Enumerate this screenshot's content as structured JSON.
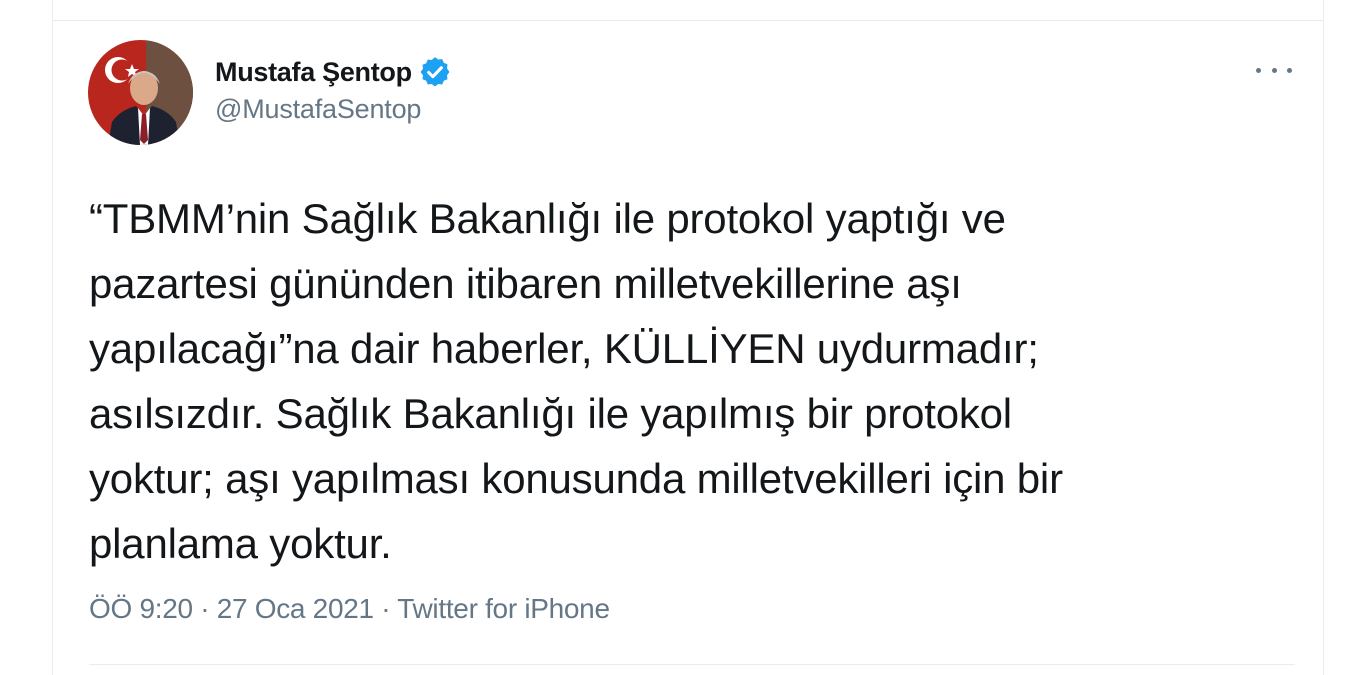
{
  "tweet": {
    "author": {
      "display_name": "Mustafa Şentop",
      "handle": "@MustafaSentop",
      "verified": true,
      "verified_color": "#1da1f2"
    },
    "more_icon": "more-horizontal-icon",
    "text_lines": [
      "“TBMM’nin Sağlık Bakanlığı ile protokol yaptığı ve",
      "pazartesi gününden itibaren milletvekillerine aşı",
      "yapılacağı”na dair haberler, KÜLLİYEN uydurmadır;",
      "asılsızdır. Sağlık Bakanlığı ile yapılmış bir protokol",
      "yoktur; aşı yapılması konusunda milletvekilleri için bir",
      "planlama yoktur."
    ],
    "meta": "ÖÖ 9:20 · 27 Oca 2021 · Twitter for iPhone"
  },
  "colors": {
    "text": "#14171a",
    "secondary": "#657786",
    "divider": "#e6ecf0"
  }
}
